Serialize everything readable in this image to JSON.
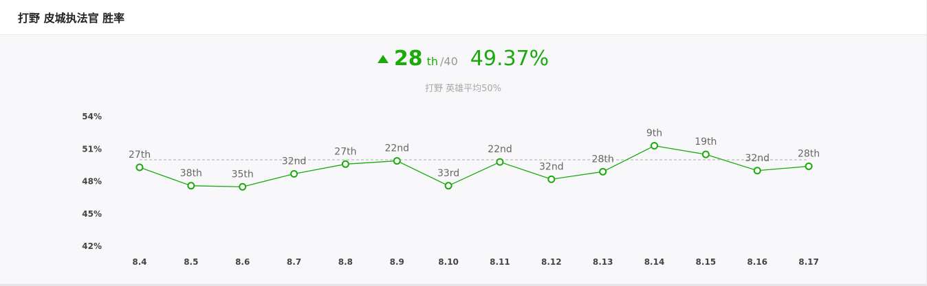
{
  "header": {
    "title": "打野 皮城执法官 胜率"
  },
  "summary": {
    "rank": "28",
    "rank_suffix": "th",
    "rank_total": "/40",
    "winrate": "49.37%",
    "avg_note": "打野 英雄平均50%",
    "trend": "up",
    "accent_color": "#1aaa0c"
  },
  "chart_data": {
    "type": "line",
    "title": "",
    "xlabel": "",
    "ylabel": "",
    "categories": [
      "8.4",
      "8.5",
      "8.6",
      "8.7",
      "8.8",
      "8.9",
      "8.10",
      "8.11",
      "8.12",
      "8.13",
      "8.14",
      "8.15",
      "8.16",
      "8.17"
    ],
    "series": [
      {
        "values": [
          49.3,
          47.6,
          47.5,
          48.7,
          49.6,
          49.9,
          47.6,
          49.8,
          48.2,
          48.9,
          51.3,
          50.5,
          49.0,
          49.4
        ],
        "point_labels": [
          "27th",
          "38th",
          "35th",
          "32nd",
          "27th",
          "22nd",
          "33rd",
          "22nd",
          "32nd",
          "28th",
          "9th",
          "19th",
          "32nd",
          "28th"
        ],
        "color": "#1aaa0c"
      }
    ],
    "reference_line": {
      "value": 50,
      "style": "dashed",
      "color": "#aaaaaa"
    },
    "yticks": [
      "54%",
      "51%",
      "48%",
      "45%",
      "42%"
    ],
    "ylim": [
      42,
      54
    ],
    "grid": false,
    "legend": "none"
  }
}
